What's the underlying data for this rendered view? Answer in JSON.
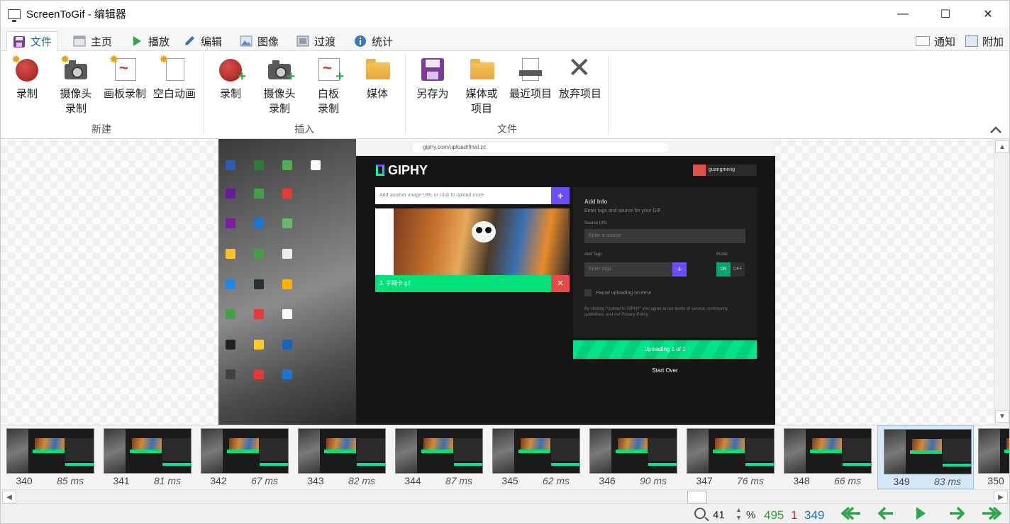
{
  "window": {
    "title": "ScreenToGif - 编辑器",
    "minimize": "—",
    "maximize": "☐",
    "close": "✕"
  },
  "tabs": [
    {
      "label": "文件",
      "icon": "save-icon"
    },
    {
      "label": "主页",
      "icon": "home-icon"
    },
    {
      "label": "播放",
      "icon": "play-icon"
    },
    {
      "label": "编辑",
      "icon": "pencil-icon"
    },
    {
      "label": "图像",
      "icon": "image-icon"
    },
    {
      "label": "过渡",
      "icon": "transition-icon"
    },
    {
      "label": "统计",
      "icon": "info-icon"
    }
  ],
  "tabs_right": [
    {
      "label": "通知",
      "icon": "notification-icon"
    },
    {
      "label": "附加",
      "icon": "extras-icon"
    }
  ],
  "ribbon": {
    "groups": [
      {
        "label": "新建",
        "buttons": [
          {
            "label": "录制",
            "icon": "record-icon"
          },
          {
            "label": "摄像头\n录制",
            "icon": "webcam-icon"
          },
          {
            "label": "画板录制",
            "icon": "board-icon"
          },
          {
            "label": "空白动画",
            "icon": "blank-page-icon"
          }
        ]
      },
      {
        "label": "插入",
        "buttons": [
          {
            "label": "录制",
            "icon": "record-insert-icon"
          },
          {
            "label": "摄像头\n录制",
            "icon": "webcam-insert-icon"
          },
          {
            "label": "白板\n录制",
            "icon": "board-insert-icon"
          },
          {
            "label": "媒体",
            "icon": "folder-icon"
          }
        ]
      },
      {
        "label": "文件",
        "buttons": [
          {
            "label": "另存为",
            "icon": "save-as-icon"
          },
          {
            "label": "媒体或\n项目",
            "icon": "open-folder-icon"
          },
          {
            "label": "最近项目",
            "icon": "recent-icon"
          },
          {
            "label": "放弃项目",
            "icon": "discard-icon"
          }
        ]
      }
    ]
  },
  "preview": {
    "url": "giphy.com/upload/final.zc",
    "brand": "GIPHY",
    "user": "guangmeng",
    "url_placeholder": "Add another image URL or click to upload more",
    "gif_name": "3. 手网卡.gif",
    "add_info": "Add Info",
    "add_info_sub": "Enter tags and source for your GIF",
    "source_url_label": "Source URL",
    "source_url_placeholder": "Enter a source",
    "add_tags_label": "Add Tags",
    "tags_placeholder": "Enter tags",
    "public_label": "Public",
    "toggle_on": "ON",
    "toggle_off": "OFF",
    "pause_label": "Pause uploading on error",
    "terms": "By clicking \"Upload to GIPHY\" you agree to our terms of service, community guidelines, and our Privacy Policy",
    "uploading": "Uploading 1 of 1",
    "start_over": "Start Over"
  },
  "frames": [
    {
      "num": "340",
      "delay": "85 ms"
    },
    {
      "num": "341",
      "delay": "81 ms"
    },
    {
      "num": "342",
      "delay": "67 ms"
    },
    {
      "num": "343",
      "delay": "82 ms"
    },
    {
      "num": "344",
      "delay": "87 ms"
    },
    {
      "num": "345",
      "delay": "62 ms"
    },
    {
      "num": "346",
      "delay": "90 ms"
    },
    {
      "num": "347",
      "delay": "76 ms"
    },
    {
      "num": "348",
      "delay": "66 ms"
    },
    {
      "num": "349",
      "delay": "83 ms",
      "selected": true
    },
    {
      "num": "350",
      "delay": ""
    }
  ],
  "status": {
    "zoom": "41",
    "percent": "%",
    "total_frames": "495",
    "selected_frames": "1",
    "current_frame": "349"
  },
  "colors": {
    "accent": "#1f5fa8",
    "record": "#c0392b",
    "nav": "#2fa44a",
    "total": "#2e9e32",
    "selected": "#c62828",
    "current": "#1a73c4"
  }
}
